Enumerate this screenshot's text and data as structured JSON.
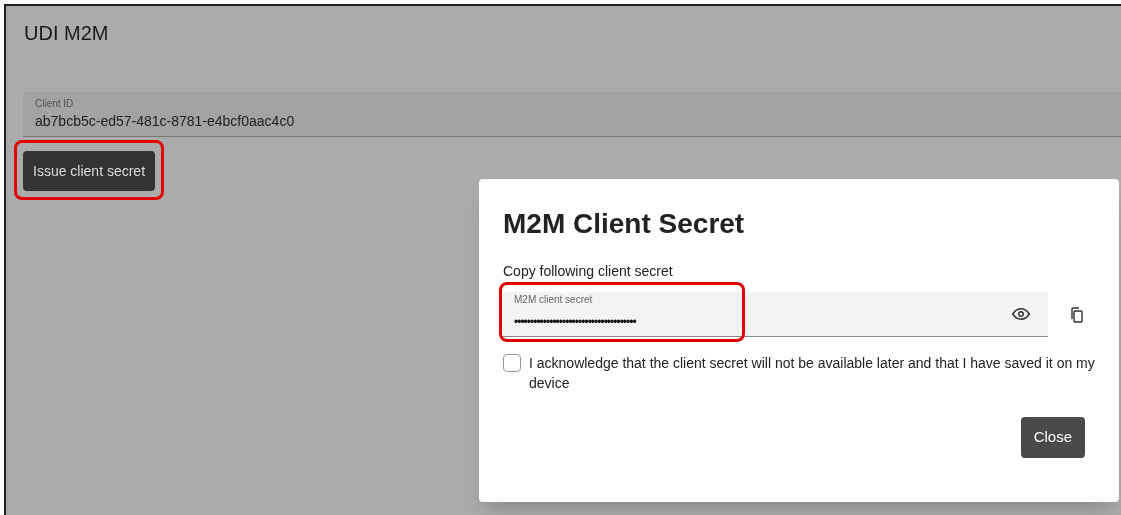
{
  "page": {
    "title": "UDI M2M"
  },
  "client_id": {
    "label": "Client ID",
    "value": "ab7bcb5c-ed57-481c-8781-e4bcf0aac4c0"
  },
  "issue_button": {
    "label": "Issue client secret",
    "highlighted": true
  },
  "dialog": {
    "title": "M2M Client Secret",
    "instruction": "Copy following client secret",
    "secret_field": {
      "label": "M2M client secret",
      "value": "••••••••••••••••••••••••••••••••••••••",
      "highlighted": true
    },
    "acknowledge": {
      "label": "I acknowledge that the client secret will not be available later and that I have saved it on my device",
      "checked": false
    },
    "close_button": "Close"
  }
}
